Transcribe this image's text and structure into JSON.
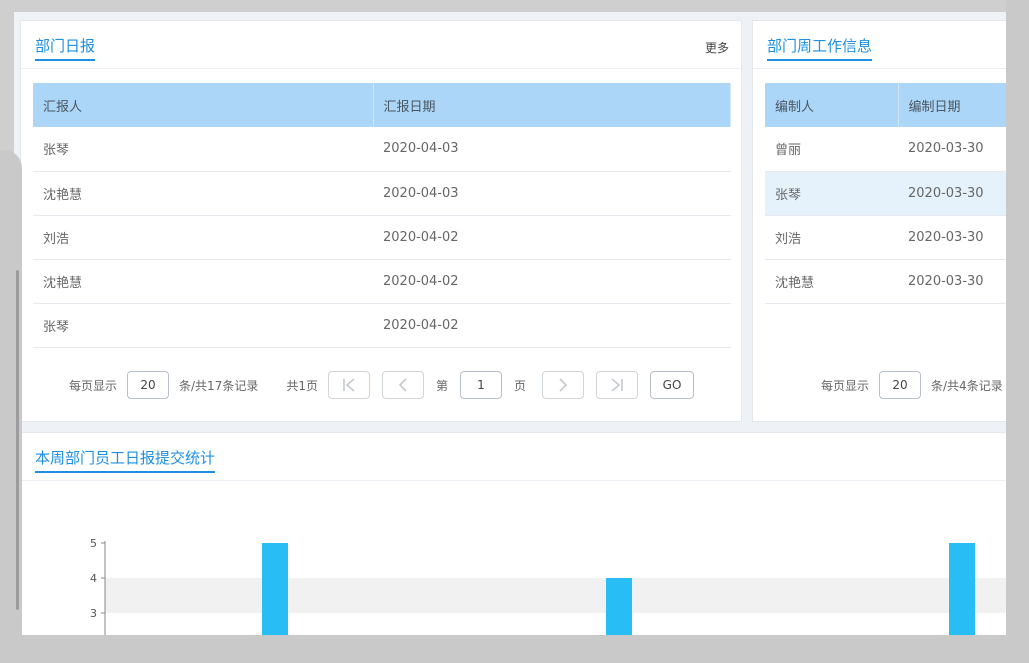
{
  "daily_panel": {
    "title": "部门日报",
    "more": "更多",
    "columns": [
      "汇报人",
      "汇报日期"
    ],
    "rows": [
      [
        "张琴",
        "2020-04-03"
      ],
      [
        "沈艳慧",
        "2020-04-03"
      ],
      [
        "刘浩",
        "2020-04-02"
      ],
      [
        "沈艳慧",
        "2020-04-02"
      ],
      [
        "张琴",
        "2020-04-02"
      ]
    ],
    "pager": {
      "per_page_label": "每页显示",
      "per_page_value": "20",
      "total_label": "条/共17条记录",
      "pages_label": "共1页",
      "page_prefix": "第",
      "page_value": "1",
      "page_suffix": "页",
      "go": "GO"
    }
  },
  "weekly_panel": {
    "title": "部门周工作信息",
    "columns": [
      "编制人",
      "编制日期"
    ],
    "rows": [
      [
        "曾丽",
        "2020-03-30"
      ],
      [
        "张琴",
        "2020-03-30"
      ],
      [
        "刘浩",
        "2020-03-30"
      ],
      [
        "沈艳慧",
        "2020-03-30"
      ]
    ],
    "highlighted_row": 1,
    "pager": {
      "per_page_label": "每页显示",
      "per_page_value": "20",
      "total_label": "条/共4条记录"
    }
  },
  "stats_panel": {
    "title": "本周部门员工日报提交统计"
  },
  "colors": {
    "accent": "#1e8fe1",
    "header_bg": "#acd6f7",
    "bar": "#29bdf6"
  },
  "icons": {
    "first": "first-page-icon",
    "prev": "prev-page-icon",
    "next": "next-page-icon",
    "last": "last-page-icon"
  },
  "chart_data": {
    "type": "bar",
    "title": "",
    "xlabel": "",
    "ylabel": "",
    "y_ticks": [
      3,
      4,
      5
    ],
    "ylim": [
      0,
      5
    ],
    "grid": "bands",
    "series": [
      {
        "values": [
          5,
          4,
          5
        ]
      }
    ]
  }
}
